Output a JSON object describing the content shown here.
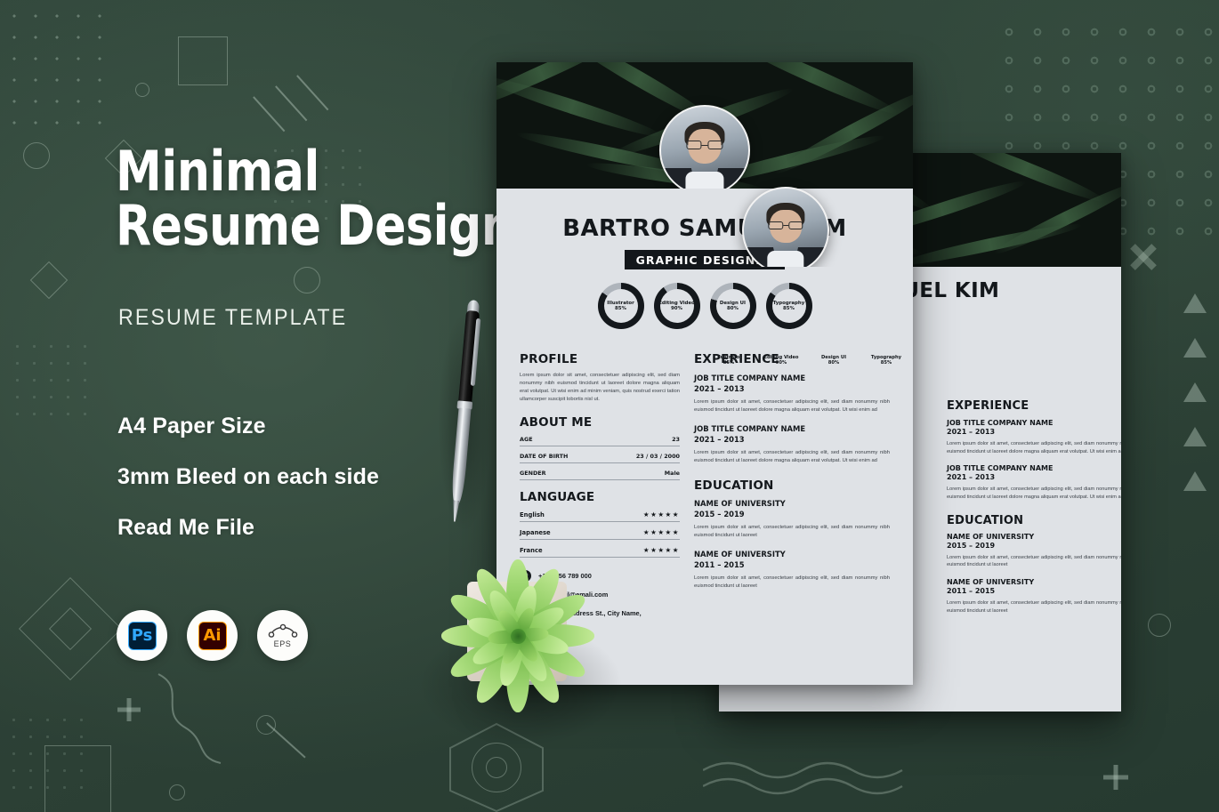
{
  "promo": {
    "headline_line1": "Minimal",
    "headline_line2": "Resume Design",
    "subhead": "RESUME TEMPLATE",
    "features": [
      "A4 Paper Size",
      "3mm Bleed on each side",
      "Read Me File"
    ],
    "badges": [
      {
        "id": "ps",
        "label": "Ps",
        "tile_color": "#001e36",
        "text_color": "#31a8ff"
      },
      {
        "id": "ai",
        "label": "Ai",
        "tile_color": "#330000",
        "text_color": "#ff9a00"
      },
      {
        "id": "eps",
        "label": "EPS",
        "tile_color": "#ffffff",
        "text_color": "#3a3a3a"
      }
    ]
  },
  "colors": {
    "background_green": "#2f4439",
    "paper": "#dfe2e6",
    "ink": "#14181c",
    "hero_dark": "#0d1410",
    "plant_green": "#8fd14f"
  },
  "resume": {
    "name": "BARTRO SAMUEL KIM",
    "role": "GRAPHIC DESIGNER",
    "skills": [
      {
        "label": "Illustrator",
        "percent": "85%",
        "value": 85
      },
      {
        "label": "Editing Video",
        "percent": "90%",
        "value": 90
      },
      {
        "label": "Design UI",
        "percent": "80%",
        "value": 80
      },
      {
        "label": "Typography",
        "percent": "85%",
        "value": 85
      }
    ],
    "profile": {
      "heading": "PROFILE",
      "text": "Lorem ipsum dolor sit amet, consectetuer adipiscing elit, sed diam nonummy nibh euismod tincidunt ut laoreet dolore magna aliquam erat volutpat. Ut wisi enim ad minim veniam, quis nostrud exerci tation ullamcorper suscipit lobortis nisl ut."
    },
    "about": {
      "heading": "ABOUT ME",
      "rows": [
        {
          "key": "AGE",
          "value": "23"
        },
        {
          "key": "DATE OF BIRTH",
          "value": "23 / 03 / 2000"
        },
        {
          "key": "GENDER",
          "value": "Male"
        }
      ]
    },
    "language": {
      "heading": "LANGUAGE",
      "rows": [
        {
          "name": "English",
          "stars": "★★★★★"
        },
        {
          "name": "Japanese",
          "stars": "★★★★★"
        },
        {
          "name": "France",
          "stars": "★★★★★"
        }
      ]
    },
    "contact": [
      {
        "icon": "phone-icon",
        "glyph": "✆",
        "text": "+123 456 789 000"
      },
      {
        "icon": "email-icon",
        "glyph": "✉",
        "text": "youremail@emali.com"
      },
      {
        "icon": "location-icon",
        "glyph": "⌖",
        "text": "123 Your Address St., City Name,"
      }
    ],
    "experience": {
      "heading": "EXPERIENCE",
      "items": [
        {
          "title": "JOB TITLE COMPANY NAME",
          "dates": "2021 – 2013",
          "text": "Lorem ipsum dolor sit amet, consectetuer adipiscing elit, sed diam nonummy nibh euismod tincidunt ut laoreet dolore magna aliquam erat volutpat. Ut wisi enim ad"
        },
        {
          "title": "JOB TITLE COMPANY NAME",
          "dates": "2021 – 2013",
          "text": "Lorem ipsum dolor sit amet, consectetuer adipiscing elit, sed diam nonummy nibh euismod tincidunt ut laoreet dolore magna aliquam erat volutpat. Ut wisi enim ad"
        }
      ]
    },
    "education": {
      "heading": "EDUCATION",
      "items": [
        {
          "title": "NAME OF UNIVERSITY",
          "dates": "2015 – 2019",
          "text": "Lorem ipsum dolor sit amet, consectetuer adipiscing elit, sed diam nonummy nibh euismod tincidunt ut laoreet"
        },
        {
          "title": "NAME OF UNIVERSITY",
          "dates": "2011 – 2015",
          "text": "Lorem ipsum dolor sit amet, consectetuer adipiscing elit, sed diam nonummy nibh euismod tincidunt ut laoreet"
        }
      ]
    }
  },
  "objects": {
    "pen": "black-silver-ballpoint-pen",
    "plant": "green-succulent-echeveria",
    "avatar": "man-with-glasses-portrait"
  }
}
